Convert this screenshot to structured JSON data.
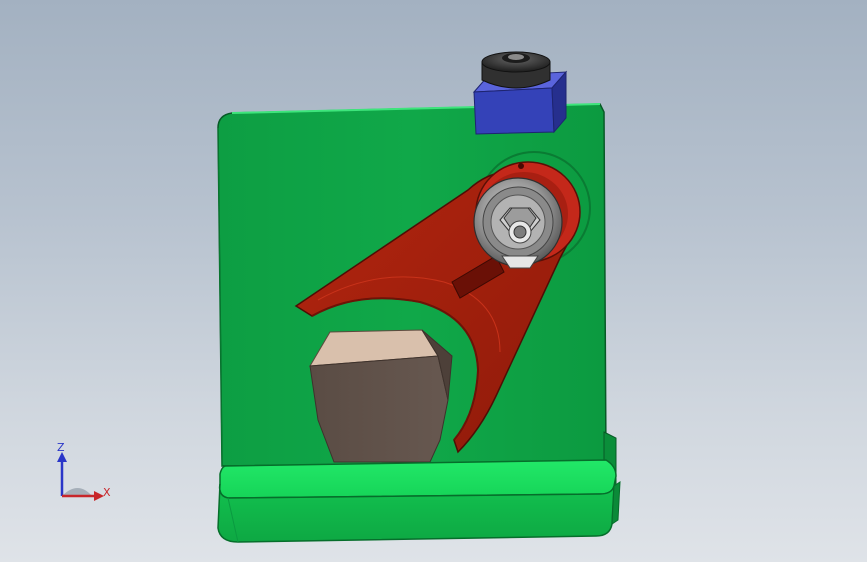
{
  "viewport": {
    "background_top": "#a3b1c1",
    "background_bottom": "#dfe3e8"
  },
  "model": {
    "parts": [
      {
        "name": "base-plate",
        "color": "#19d95a"
      },
      {
        "name": "back-plate",
        "color": "#0fa848"
      },
      {
        "name": "clamp-arm",
        "color": "#a3200f"
      },
      {
        "name": "pivot-collar",
        "color": "#c4281a"
      },
      {
        "name": "bearing",
        "color": "#8a8a8a"
      },
      {
        "name": "hex-nut",
        "color": "#c8c8c8"
      },
      {
        "name": "bracket-block",
        "color": "#3340b5"
      },
      {
        "name": "top-knob",
        "color": "#2a2a2a"
      },
      {
        "name": "workpiece",
        "color": "#5e5048"
      }
    ]
  },
  "triad": {
    "z_label": "Z",
    "x_label": "X",
    "z_color": "#2a36c8",
    "x_color": "#c8262a"
  }
}
